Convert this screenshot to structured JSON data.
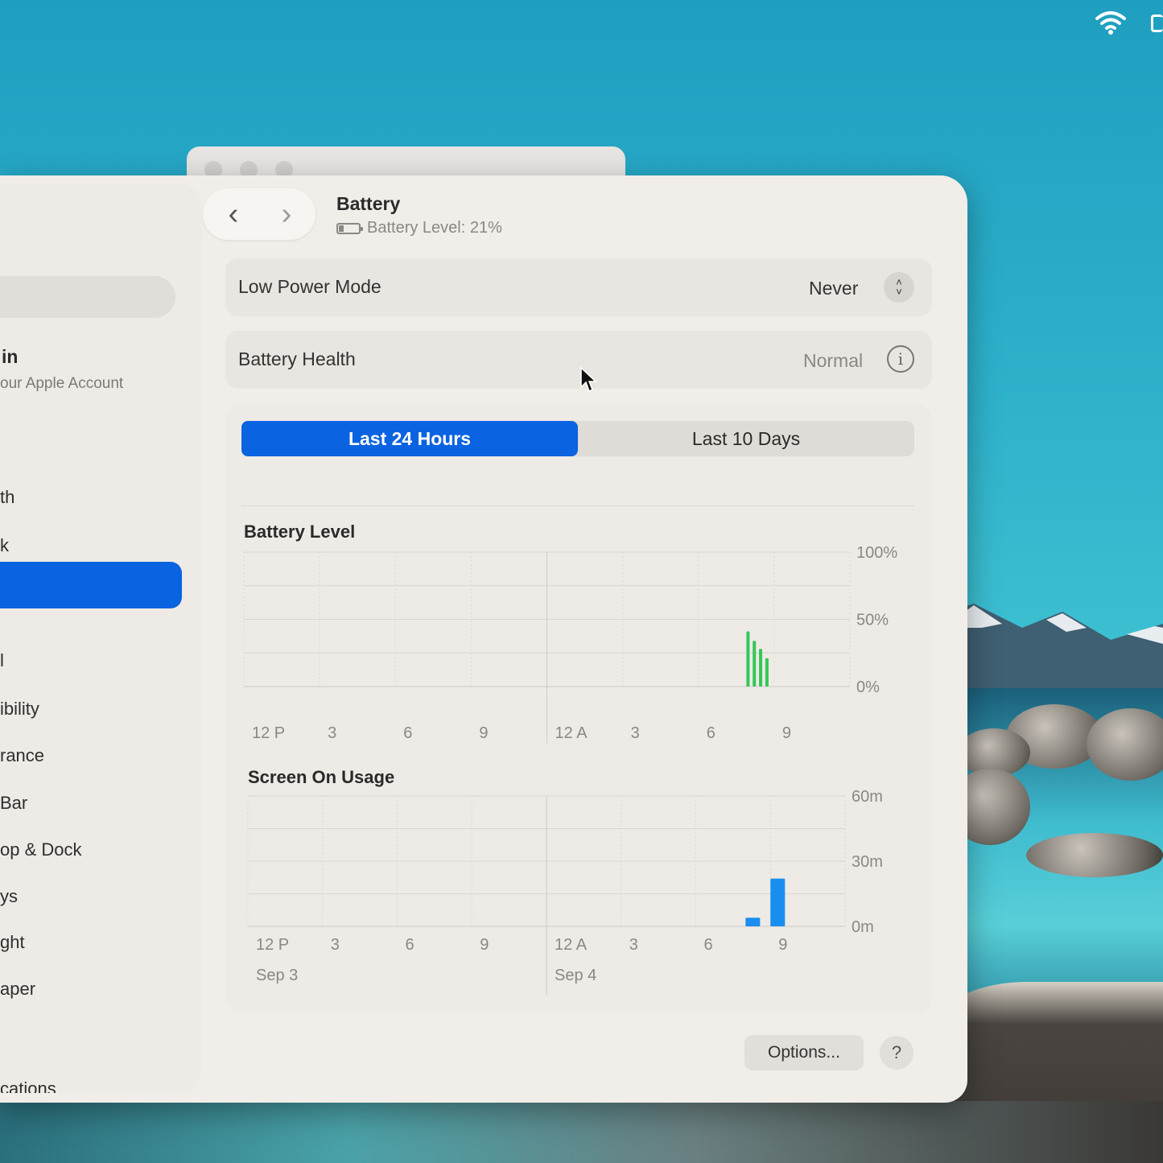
{
  "window": {
    "title": "Battery",
    "subtitle": "Battery Level: 21%",
    "battery_icon": "battery-low-icon"
  },
  "sidebar": {
    "account_name": "in",
    "account_sub": "our Apple Account",
    "items": [
      {
        "label": "th"
      },
      {
        "label": "k"
      },
      {
        "label": ""
      },
      {
        "label": "l"
      },
      {
        "label": "ibility"
      },
      {
        "label": "rance"
      },
      {
        "label": "Bar"
      },
      {
        "label": "op & Dock"
      },
      {
        "label": "ys"
      },
      {
        "label": "ght"
      },
      {
        "label": "aper"
      },
      {
        "label": "cations"
      }
    ],
    "selected_index": 2
  },
  "rows": {
    "low_power_mode": {
      "label": "Low Power Mode",
      "value": "Never"
    },
    "battery_health": {
      "label": "Battery Health",
      "value": "Normal"
    }
  },
  "segment": {
    "options": [
      "Last 24 Hours",
      "Last 10 Days"
    ],
    "selected": "Last 24 Hours"
  },
  "footer": {
    "options_label": "Options...",
    "help_label": "?"
  },
  "colors": {
    "accent": "#0a63e0",
    "battery_bar": "#34c759",
    "usage_bar": "#1a8ef0"
  },
  "chart_data": [
    {
      "type": "bar",
      "title": "Battery Level",
      "x_tick_labels": [
        "12 P",
        "3",
        "6",
        "9",
        "12 A",
        "3",
        "6",
        "9"
      ],
      "y_tick_labels": [
        "100%",
        "50%",
        "0%"
      ],
      "ylim": [
        0,
        100
      ],
      "series": [
        {
          "values": [
            {
              "hour_from_start": 19.9,
              "value": 41
            },
            {
              "hour_from_start": 20.15,
              "value": 34
            },
            {
              "hour_from_start": 20.4,
              "value": 28
            },
            {
              "hour_from_start": 20.65,
              "value": 21
            }
          ]
        }
      ]
    },
    {
      "type": "bar",
      "title": "Screen On Usage",
      "x_tick_labels": [
        "12 P",
        "3",
        "6",
        "9",
        "12 A",
        "3",
        "6",
        "9"
      ],
      "date_labels": [
        "Sep 3",
        "Sep 4"
      ],
      "y_tick_labels": [
        "60m",
        "30m",
        "0m"
      ],
      "ylim": [
        0,
        60
      ],
      "series": [
        {
          "values": [
            {
              "hour": 20,
              "value": 4
            },
            {
              "hour": 21,
              "value": 22
            }
          ]
        }
      ]
    }
  ]
}
